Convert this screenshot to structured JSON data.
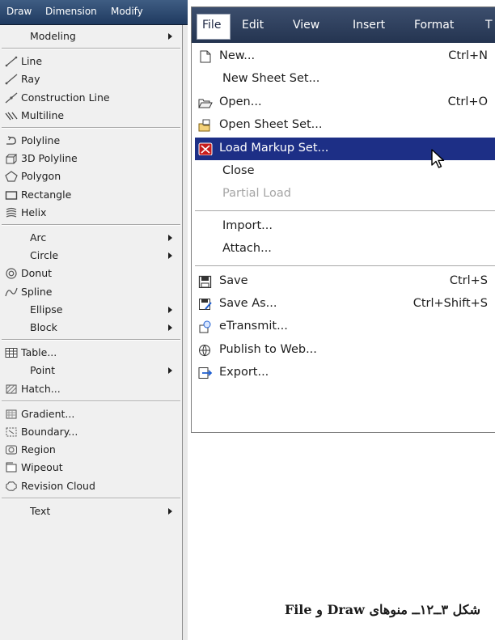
{
  "draw_menu": {
    "menubar": [
      "Draw",
      "Dimension",
      "Modify"
    ],
    "items": [
      {
        "type": "item",
        "label": "Modeling",
        "icon": null,
        "submenu": true
      },
      {
        "type": "sep"
      },
      {
        "type": "item",
        "label": "Line",
        "icon": "line-icon",
        "submenu": false
      },
      {
        "type": "item",
        "label": "Ray",
        "icon": "ray-icon",
        "submenu": false
      },
      {
        "type": "item",
        "label": "Construction Line",
        "icon": "construction-line-icon",
        "submenu": false
      },
      {
        "type": "item",
        "label": "Multiline",
        "icon": "multiline-icon",
        "submenu": false
      },
      {
        "type": "sep"
      },
      {
        "type": "item",
        "label": "Polyline",
        "icon": "polyline-icon",
        "submenu": false
      },
      {
        "type": "item",
        "label": "3D Polyline",
        "icon": "3d-polyline-icon",
        "submenu": false
      },
      {
        "type": "item",
        "label": "Polygon",
        "icon": "polygon-icon",
        "submenu": false
      },
      {
        "type": "item",
        "label": "Rectangle",
        "icon": "rectangle-icon",
        "submenu": false
      },
      {
        "type": "item",
        "label": "Helix",
        "icon": "helix-icon",
        "submenu": false
      },
      {
        "type": "sep"
      },
      {
        "type": "item",
        "label": "Arc",
        "icon": null,
        "submenu": true
      },
      {
        "type": "item",
        "label": "Circle",
        "icon": null,
        "submenu": true
      },
      {
        "type": "item",
        "label": "Donut",
        "icon": "donut-icon",
        "submenu": false
      },
      {
        "type": "item",
        "label": "Spline",
        "icon": "spline-icon",
        "submenu": false
      },
      {
        "type": "item",
        "label": "Ellipse",
        "icon": null,
        "submenu": true
      },
      {
        "type": "item",
        "label": "Block",
        "icon": null,
        "submenu": true
      },
      {
        "type": "sep"
      },
      {
        "type": "item",
        "label": "Table...",
        "icon": "table-icon",
        "submenu": false
      },
      {
        "type": "item",
        "label": "Point",
        "icon": null,
        "submenu": true
      },
      {
        "type": "item",
        "label": "Hatch...",
        "icon": "hatch-icon",
        "submenu": false
      },
      {
        "type": "sep"
      },
      {
        "type": "item",
        "label": "Gradient...",
        "icon": "gradient-icon",
        "submenu": false
      },
      {
        "type": "item",
        "label": "Boundary...",
        "icon": "boundary-icon",
        "submenu": false
      },
      {
        "type": "item",
        "label": "Region",
        "icon": "region-icon",
        "submenu": false
      },
      {
        "type": "item",
        "label": "Wipeout",
        "icon": "wipeout-icon",
        "submenu": false
      },
      {
        "type": "item",
        "label": "Revision Cloud",
        "icon": "revision-cloud-icon",
        "submenu": false
      },
      {
        "type": "sep"
      },
      {
        "type": "item",
        "label": "Text",
        "icon": null,
        "submenu": true
      }
    ]
  },
  "file_menu": {
    "menubar": [
      "File",
      "Edit",
      "View",
      "Insert",
      "Format",
      "T"
    ],
    "items": [
      {
        "type": "item",
        "label": "New...",
        "shortcut": "Ctrl+N",
        "icon": "new-document-icon",
        "state": "normal"
      },
      {
        "type": "item",
        "label": "New Sheet Set...",
        "shortcut": "",
        "icon": null,
        "state": "normal"
      },
      {
        "type": "item",
        "label": "Open...",
        "shortcut": "Ctrl+O",
        "icon": "open-folder-icon",
        "state": "normal"
      },
      {
        "type": "item",
        "label": "Open Sheet Set...",
        "shortcut": "",
        "icon": "open-sheet-set-icon",
        "state": "normal"
      },
      {
        "type": "item",
        "label": "Load Markup Set...",
        "shortcut": "",
        "icon": "load-markup-icon",
        "state": "highlighted"
      },
      {
        "type": "item",
        "label": "Close",
        "shortcut": "",
        "icon": null,
        "state": "normal"
      },
      {
        "type": "item",
        "label": "Partial Load",
        "shortcut": "",
        "icon": null,
        "state": "disabled"
      },
      {
        "type": "sep"
      },
      {
        "type": "item",
        "label": "Import...",
        "shortcut": "",
        "icon": null,
        "state": "normal"
      },
      {
        "type": "item",
        "label": "Attach...",
        "shortcut": "",
        "icon": null,
        "state": "normal"
      },
      {
        "type": "sep"
      },
      {
        "type": "item",
        "label": "Save",
        "shortcut": "Ctrl+S",
        "icon": "save-icon",
        "state": "normal"
      },
      {
        "type": "item",
        "label": "Save As...",
        "shortcut": "Ctrl+Shift+S",
        "icon": "save-as-icon",
        "state": "normal"
      },
      {
        "type": "item",
        "label": "eTransmit...",
        "shortcut": "",
        "icon": "etransmit-icon",
        "state": "normal"
      },
      {
        "type": "item",
        "label": "Publish to Web...",
        "shortcut": "",
        "icon": "publish-web-icon",
        "state": "normal"
      },
      {
        "type": "item",
        "label": "Export...",
        "shortcut": "",
        "icon": "export-icon",
        "state": "normal"
      }
    ]
  },
  "caption": "شکل ۳ــ۱۲ــ منوهای Draw و File",
  "colors": {
    "highlight": "#1d2f86",
    "menubar": "#2a3d5e",
    "menu_bg": "#f0f0f0",
    "disabled_text": "#a5a5a5"
  }
}
